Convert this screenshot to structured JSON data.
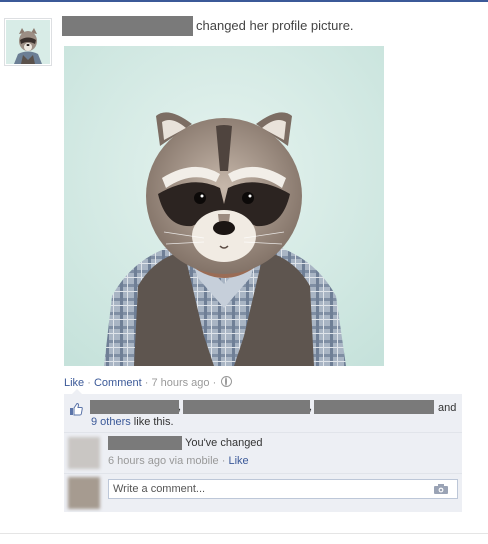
{
  "story": {
    "action_text": "changed her profile picture."
  },
  "actions": {
    "like": "Like",
    "sep1": " · ",
    "comment": "Comment",
    "sep2": " · ",
    "time": "7 hours ago",
    "sep3": " · "
  },
  "likes": {
    "and_text": "and",
    "others_link": "9 others",
    "others_suffix": " like this."
  },
  "comment": {
    "text": "You've changed",
    "time": "6 hours ago via mobile",
    "sep": " · ",
    "like": "Like"
  },
  "composer": {
    "placeholder": "Write a comment..."
  },
  "icons": {
    "like": "thumbs-up-icon",
    "privacy": "globe-icon",
    "photo": "camera-icon"
  },
  "colors": {
    "link": "#3b5998",
    "ufi_bg": "#edeff4",
    "redaction": "#7a7a7a",
    "photo_bg": "#d6ebe6"
  }
}
